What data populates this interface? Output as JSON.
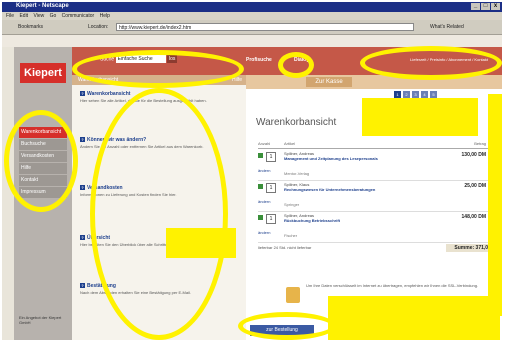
{
  "window": {
    "title": "Kiepert - Netscape",
    "controls": [
      "_",
      "□",
      "x"
    ]
  },
  "menu": [
    "File",
    "Edit",
    "View",
    "Go",
    "Communicator",
    "Help"
  ],
  "toolbar": {
    "bookmarks_label": "Bookmarks",
    "location_label": "Location:",
    "url": "http://www.kiepert.de/index2.htm",
    "related_label": "What's Related"
  },
  "site": {
    "logo": "Kiepert",
    "search": {
      "label": "Suche",
      "value": "Einfache Suche",
      "button": "los"
    },
    "nav": {
      "profisuche": "Profisuche",
      "dialog": "Dialog"
    },
    "top_right": "Lieferzeit / Preisinfo / Abonnement / Kontakt",
    "left_nav": [
      "Warenkorbansicht",
      "Buchsuche",
      "Versandkosten",
      "Hilfe",
      "Kontakt",
      "Impressum"
    ],
    "left_footer": "Ein Angebot der Kiepert GmbH"
  },
  "mid": {
    "subhead": "Warenkorbansicht",
    "hilfe": "Hilfe",
    "sections": [
      {
        "heading": "Warenkorbansicht",
        "body": "Hier sehen Sie alle Artikel, die Sie für die Bestellung ausgewählt haben."
      },
      {
        "heading": "Können wir was ändern?",
        "body": "Ändern Sie die Anzahl oder entfernen Sie Artikel aus dem Warenkorb."
      },
      {
        "heading": "Versandkosten",
        "body": "Informationen zu Lieferung und Kosten finden Sie hier."
      },
      {
        "heading": "Übersicht",
        "body": "Hier behalten Sie den Überblick über alle Schritte der Bestellung."
      },
      {
        "heading": "Bestätigung",
        "body": "Nach dem Absenden erhalten Sie eine Bestätigung per E-Mail."
      }
    ]
  },
  "cart": {
    "banner_tab": "Zur Kasse",
    "title": "Warenkorbansicht",
    "steps": [
      "1",
      "2",
      "3",
      "4",
      "5"
    ],
    "columns": {
      "qty": "Anzahl",
      "item": "Artikel",
      "price": "Betrag"
    },
    "items": [
      {
        "qty": "1",
        "author": "Spillner, Andreas",
        "title": "Management und Zeitplanung des Lesepersonals",
        "publisher": "Mentor-Verlag",
        "price": "130,00 DM"
      },
      {
        "qty": "1",
        "author": "Spillner, Klaus",
        "title": "Rechnungswesen für Unternehmensberatungen",
        "publisher": "Springer",
        "price": "25,00 DM"
      },
      {
        "qty": "1",
        "author": "Spillner, Andreas",
        "title": "Rückbuchung Betriebsschrift",
        "publisher": "Fischer",
        "price": "148,00 DM"
      }
    ],
    "change_label": "ändern",
    "legend": "lieferbar   24 Std.   nicht lieferbar",
    "total_label": "Summe: 371,00 DM",
    "notice": "Um Ihre Daten verschlüsselt im Internet zu übertragen, empfehlen wir Ihnen die SSL-Verbindung.",
    "order_button": "zur Bestellung"
  },
  "annotations": {
    "colors": {
      "highlight": "#fff200",
      "brand": "#d62f2a",
      "link": "#1d3f8c"
    }
  }
}
